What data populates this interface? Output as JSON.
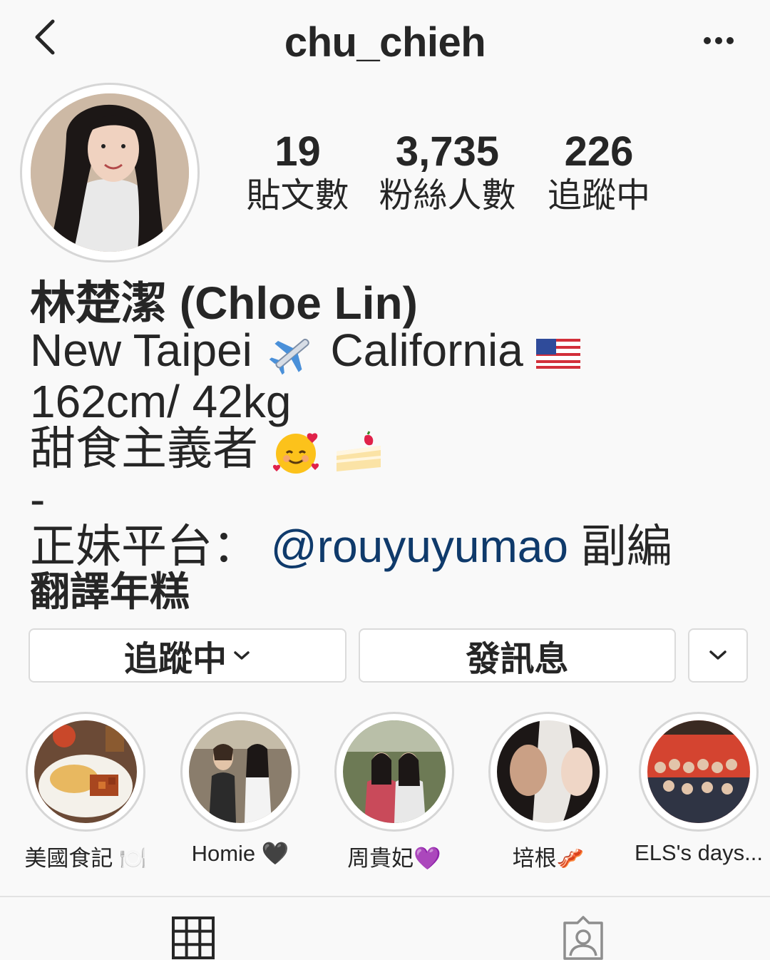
{
  "header": {
    "username": "chu_chieh",
    "back_icon": "chevron-left-icon",
    "more_icon": "more-horizontal-icon"
  },
  "stats": [
    {
      "value": "19",
      "label": "貼文數"
    },
    {
      "value": "3,735",
      "label": "粉絲人數"
    },
    {
      "value": "226",
      "label": "追蹤中"
    }
  ],
  "bio": {
    "name": "林楚潔 (Chloe Lin)",
    "location_from": "New Taipei",
    "location_to": "California",
    "stats_line": "162cm/ 42kg",
    "tagline": "甜食主義者",
    "dash": "-",
    "platform_prefix": "正妹平台：",
    "mention": "@rouyuyumao",
    "role": "副編",
    "extra": "翻譯年糕"
  },
  "buttons": {
    "following": "追蹤中",
    "message": "發訊息"
  },
  "highlights": [
    {
      "label": "美國食記 🍽️"
    },
    {
      "label": "Homie 🖤"
    },
    {
      "label": "周貴妃💜"
    },
    {
      "label": "培根🥓"
    },
    {
      "label": "ELS's days..."
    }
  ],
  "colors": {
    "mention": "#0f3a6b",
    "text": "#262626",
    "border": "#dbdbdb",
    "background": "#f9f9f9"
  }
}
